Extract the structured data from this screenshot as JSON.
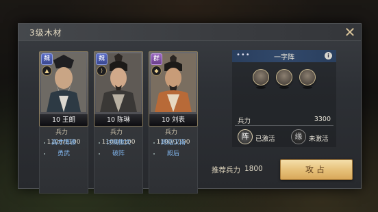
{
  "dialog": {
    "title": "3级木材",
    "close_glyph": "✕"
  },
  "heroes": [
    {
      "faction": "魏",
      "faction_color": "#4a5ab0",
      "role_icon": "fire-icon",
      "name": "10 王朗",
      "troops_label": "兵力",
      "troops": "1100/1100",
      "skills": [
        "高才博雅",
        "勇武"
      ]
    },
    {
      "faction": "魏",
      "faction_color": "#4a5ab0",
      "role_icon": "bow-icon",
      "name": "10 陈琳",
      "troops_label": "兵力",
      "troops": "1100/1100",
      "skills": [
        "讨贼檄文",
        "破阵"
      ]
    },
    {
      "faction": "群",
      "faction_color": "#7b4fa0",
      "role_icon": "shield-icon",
      "name": "10 刘表",
      "troops_label": "兵力",
      "troops": "1100/1100",
      "skills": [
        "跨蹈汉南",
        "殿后"
      ]
    }
  ],
  "formation": {
    "menu_glyph": "•••",
    "name": "一字阵",
    "info_glyph": "i",
    "troops_label": "兵力",
    "troops_value": "3300",
    "status": [
      {
        "glyph": "阵",
        "label": "已激活"
      },
      {
        "glyph": "缘",
        "label": "未激活"
      }
    ]
  },
  "recommend": {
    "label": "推荐兵力",
    "value": "1800"
  },
  "attack_button": "攻占"
}
